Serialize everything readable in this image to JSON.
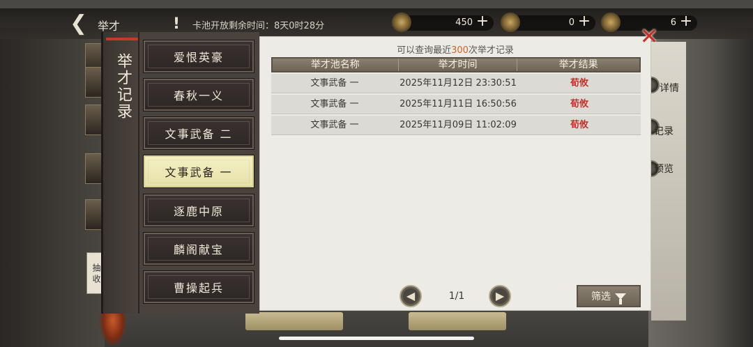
{
  "topbar": {
    "back_title": "举才",
    "notice_icon": "!",
    "notice_text": "卡池开放剩余时间：8天0时28分",
    "resources": [
      {
        "icon": "coin-icon",
        "value": "450"
      },
      {
        "icon": "token-icon",
        "value": "0"
      },
      {
        "icon": "ticket-icon",
        "value": "6"
      }
    ]
  },
  "panel": {
    "title": "举才记录",
    "query_prefix": "可以查询最近",
    "query_count": "300",
    "query_suffix": "次举才记录",
    "close_label": "✕"
  },
  "menu": {
    "items": [
      {
        "label": "爱恨英豪",
        "active": false
      },
      {
        "label": "春秋一义",
        "active": false
      },
      {
        "label": "文事武备 二",
        "active": false
      },
      {
        "label": "文事武备 一",
        "active": true
      },
      {
        "label": "逐鹿中原",
        "active": false
      },
      {
        "label": "麟阁献宝",
        "active": false
      },
      {
        "label": "曹操起兵",
        "active": false
      }
    ]
  },
  "table": {
    "headers": [
      "举才池名称",
      "举才时间",
      "举才结果"
    ],
    "rows": [
      {
        "pool": "文事武备 一",
        "time": "2025年11月12日  23:30:51",
        "result": "荀攸"
      },
      {
        "pool": "文事武备 一",
        "time": "2025年11月11日  16:50:56",
        "result": "荀攸"
      },
      {
        "pool": "文事武备 一",
        "time": "2025年11月09日  11:02:09",
        "result": "荀攸"
      }
    ]
  },
  "pager": {
    "page_text": "1/1"
  },
  "filter": {
    "label": "筛选"
  },
  "background": {
    "right_labels": [
      "详情",
      "记录",
      "预览"
    ],
    "side_tab": "抽 收"
  },
  "colors": {
    "accent_red": "#c4302a",
    "highlight_orange": "#d4612a",
    "active_menu": "#f4f0c4"
  }
}
